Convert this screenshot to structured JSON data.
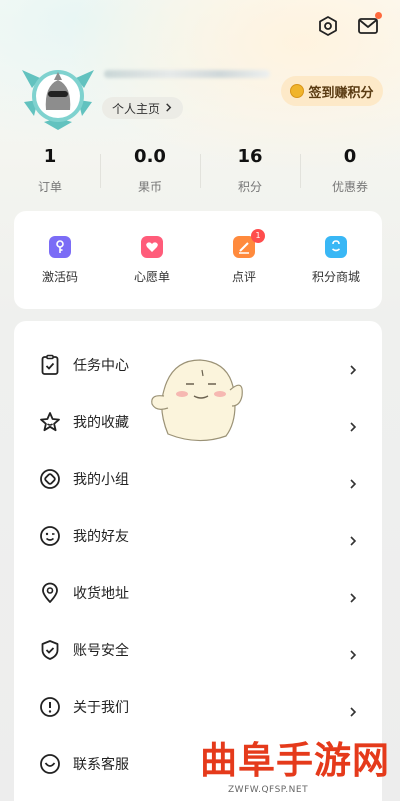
{
  "header": {
    "settings_icon": "settings-hexagon-icon",
    "mail_icon": "mail-icon",
    "profile_link": "个人主页",
    "checkin_label": "签到赚积分",
    "accent": "#f0b42c"
  },
  "stats": [
    {
      "value": "1",
      "label": "订单"
    },
    {
      "value": "0.0",
      "label": "果币"
    },
    {
      "value": "16",
      "label": "积分"
    },
    {
      "value": "0",
      "label": "优惠券"
    }
  ],
  "quick_actions": [
    {
      "label": "激活码",
      "icon": "key-icon",
      "color": "#7b6cf6"
    },
    {
      "label": "心愿单",
      "icon": "heart-icon",
      "color": "#ff5c7a"
    },
    {
      "label": "点评",
      "icon": "pen-icon",
      "color": "#ff8a3d",
      "badge": "1"
    },
    {
      "label": "积分商城",
      "icon": "shopping-bag-icon",
      "color": "#39b7f5"
    }
  ],
  "menu": [
    {
      "label": "任务中心",
      "icon": "clipboard-check-icon"
    },
    {
      "label": "我的收藏",
      "icon": "star-icon"
    },
    {
      "label": "我的小组",
      "icon": "group-icon"
    },
    {
      "label": "我的好友",
      "icon": "wink-face-icon"
    },
    {
      "label": "收货地址",
      "icon": "location-pin-icon"
    },
    {
      "label": "账号安全",
      "icon": "shield-check-icon"
    },
    {
      "label": "关于我们",
      "icon": "info-circle-icon"
    },
    {
      "label": "联系客服",
      "icon": "customer-service-icon"
    }
  ],
  "watermark": {
    "title": "曲阜手游网",
    "subtitle": "ZWFW.QFSP.NET"
  }
}
